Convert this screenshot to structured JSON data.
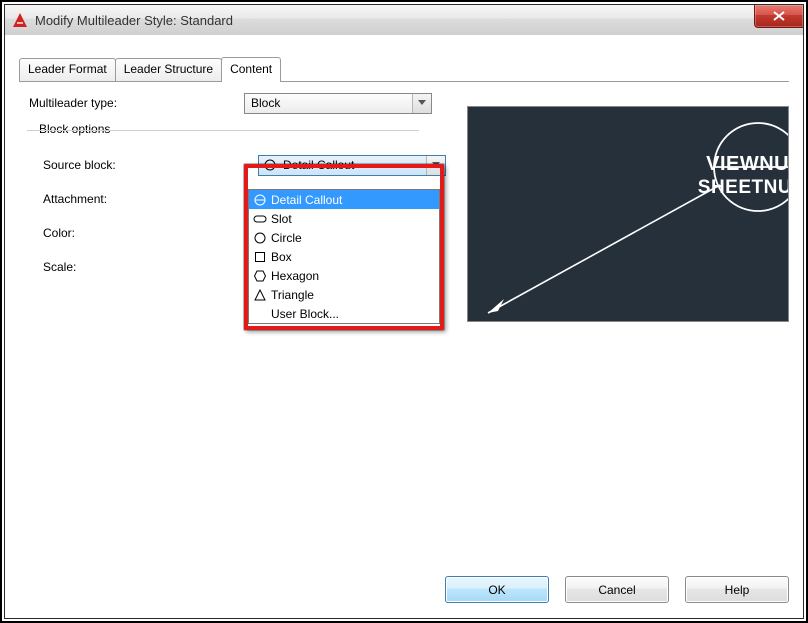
{
  "window": {
    "title": "Modify Multileader Style: Standard"
  },
  "tabs": {
    "leader_format": "Leader Format",
    "leader_structure": "Leader Structure",
    "content": "Content"
  },
  "labels": {
    "multileader_type": "Multileader type:",
    "block_options": "Block options",
    "source_block": "Source block:",
    "attachment": "Attachment:",
    "color": "Color:",
    "scale": "Scale:"
  },
  "values": {
    "multileader_type": "Block",
    "source_block": "Detail Callout"
  },
  "dropdown": {
    "items": [
      {
        "label": "Detail Callout",
        "icon": "circle-hline"
      },
      {
        "label": "Slot",
        "icon": "slot"
      },
      {
        "label": "Circle",
        "icon": "circle"
      },
      {
        "label": "Box",
        "icon": "box"
      },
      {
        "label": "Hexagon",
        "icon": "hexagon"
      },
      {
        "label": "Triangle",
        "icon": "triangle"
      },
      {
        "label": "User Block...",
        "icon": ""
      }
    ],
    "selected_index": 0
  },
  "preview": {
    "line1": "VIEWNUMBER",
    "line2": "SHEETNUMBER"
  },
  "buttons": {
    "ok": "OK",
    "cancel": "Cancel",
    "help": "Help"
  }
}
